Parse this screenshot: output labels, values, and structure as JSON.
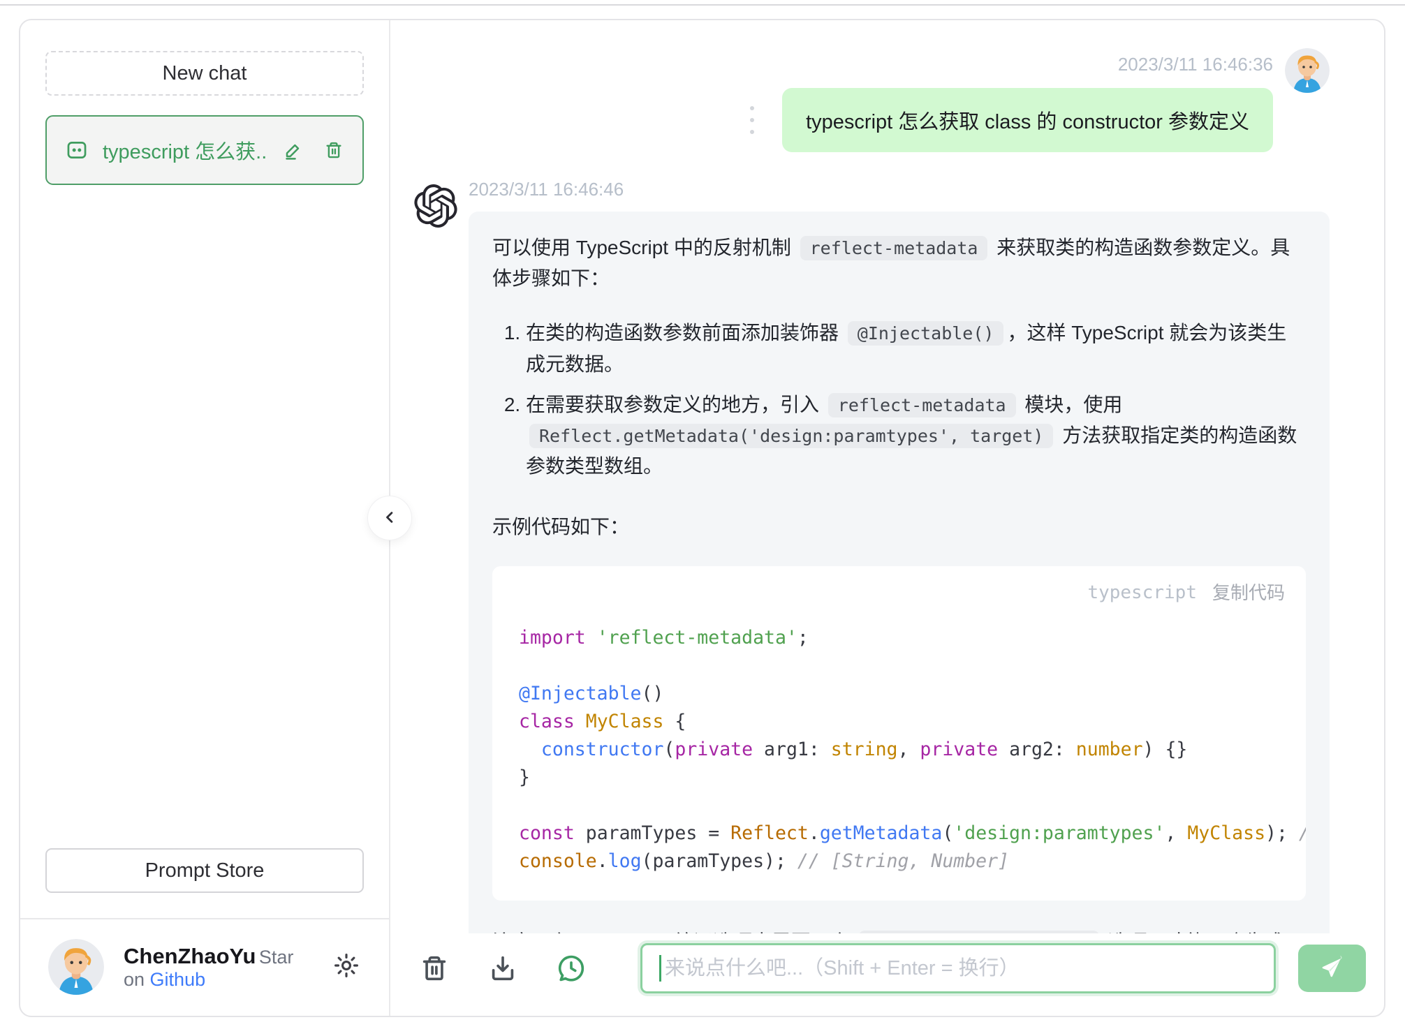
{
  "sidebar": {
    "new_chat_label": "New chat",
    "chat_item": {
      "title": "typescript 怎么获..."
    },
    "prompt_store_label": "Prompt Store",
    "profile": {
      "name": "ChenZhaoYu",
      "star_prefix": "Star on ",
      "github_link": "Github"
    }
  },
  "chat": {
    "user": {
      "timestamp": "2023/3/11 16:46:36",
      "message": "typescript 怎么获取 class 的 constructor 参数定义"
    },
    "assistant": {
      "timestamp": "2023/3/11 16:46:46",
      "intro": [
        {
          "t": "可以使用 TypeScript 中的反射机制 "
        },
        {
          "c": "reflect-metadata"
        },
        {
          "t": " 来获取类的构造函数参数定义。具体步骤如下："
        }
      ],
      "steps": [
        [
          {
            "t": "在类的构造函数参数前面添加装饰器 "
          },
          {
            "c": "@Injectable()"
          },
          {
            "t": "，这样 TypeScript 就会为该类生成元数据。"
          }
        ],
        [
          {
            "t": "在需要获取参数定义的地方，引入 "
          },
          {
            "c": "reflect-metadata"
          },
          {
            "t": " 模块，使用 "
          },
          {
            "c": "Reflect.getMetadata('design:paramtypes', target)"
          },
          {
            "t": " 方法获取指定类的构造函数参数类型数组。"
          }
        ]
      ],
      "example_label": "示例代码如下：",
      "code_block": {
        "lang": "typescript",
        "copy_label": "复制代码",
        "lines": [
          [
            [
              "kw",
              "import"
            ],
            [
              "pl",
              " "
            ],
            [
              "str",
              "'reflect-metadata'"
            ],
            [
              "pl",
              ";"
            ]
          ],
          [],
          [
            [
              "fn",
              "@Injectable"
            ],
            [
              "pl",
              "()"
            ]
          ],
          [
            [
              "kw",
              "class"
            ],
            [
              "pl",
              " "
            ],
            [
              "ty",
              "MyClass"
            ],
            [
              "pl",
              " {"
            ]
          ],
          [
            [
              "pl",
              "  "
            ],
            [
              "fn",
              "constructor"
            ],
            [
              "pl",
              "("
            ],
            [
              "kw",
              "private"
            ],
            [
              "pl",
              " arg1: "
            ],
            [
              "ty",
              "string"
            ],
            [
              "pl",
              ", "
            ],
            [
              "kw",
              "private"
            ],
            [
              "pl",
              " arg2: "
            ],
            [
              "ty",
              "number"
            ],
            [
              "pl",
              ") {}"
            ]
          ],
          [
            [
              "pl",
              "}"
            ]
          ],
          [],
          [
            [
              "kw",
              "const"
            ],
            [
              "pl",
              " paramTypes = "
            ],
            [
              "bi",
              "Reflect"
            ],
            [
              "pl",
              "."
            ],
            [
              "fn",
              "getMetadata"
            ],
            [
              "pl",
              "("
            ],
            [
              "str",
              "'design:paramtypes'"
            ],
            [
              "pl",
              ", "
            ],
            [
              "ty",
              "MyClass"
            ],
            [
              "pl",
              "); "
            ],
            [
              "cm",
              "// 获取 My"
            ]
          ],
          [
            [
              "bi",
              "console"
            ],
            [
              "pl",
              "."
            ],
            [
              "fn",
              "log"
            ],
            [
              "pl",
              "(paramTypes); "
            ],
            [
              "cm",
              "// [String, Number]"
            ]
          ]
        ]
      },
      "note": [
        {
          "t": "注意：在 TypeScript 编译选项中需要开启 "
        },
        {
          "c": "emitDecoratorMetadata"
        },
        {
          "t": " 选项，才能正确生成元数据。"
        }
      ]
    }
  },
  "composer": {
    "placeholder": "来说点什么吧...（Shift + Enter = 换行）"
  },
  "icons": [
    "message-icon",
    "edit-icon",
    "trash-icon",
    "gear-icon",
    "chevron-left-icon",
    "openai-logo",
    "refresh-icon",
    "more-dots-icon",
    "download-icon",
    "chat-history-icon",
    "send-plane-icon"
  ],
  "colors": {
    "accent_green": "#4f9e68",
    "user_bubble": "#d2f9d1",
    "assistant_bubble": "#f4f6f8",
    "send_button": "#90d5a3",
    "link_blue": "#3e7bfa"
  }
}
